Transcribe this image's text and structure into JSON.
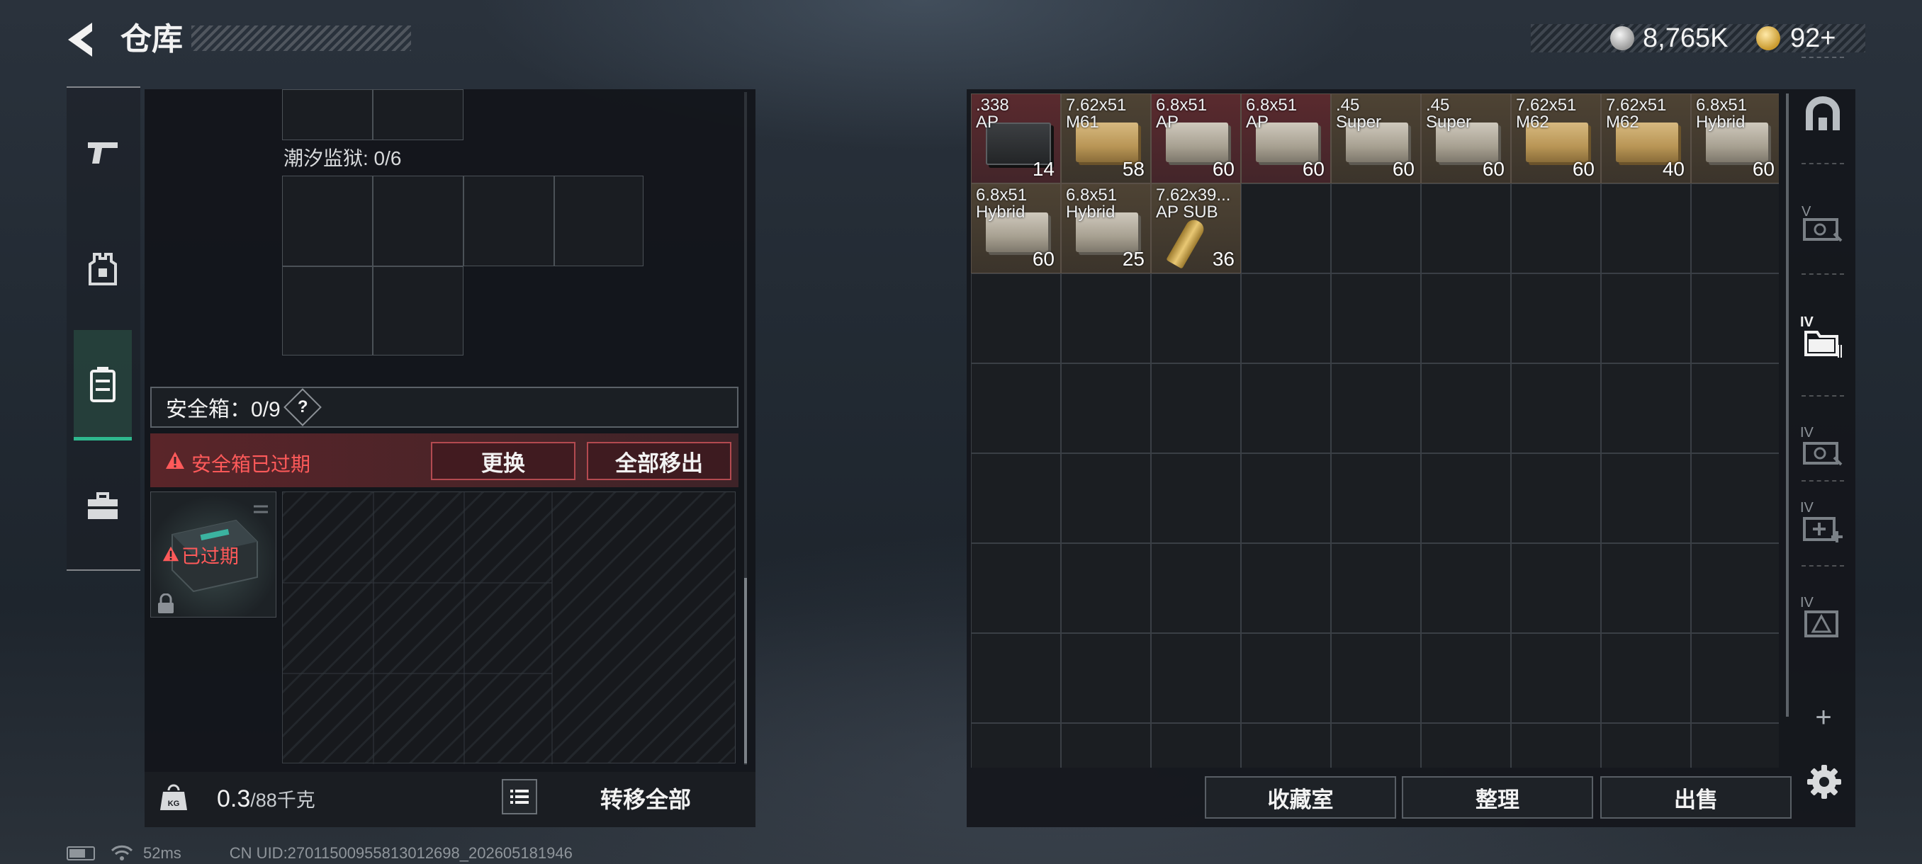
{
  "header": {
    "title": "仓库"
  },
  "currency": {
    "silver": "8,765K",
    "gold": "92+"
  },
  "left_panel": {
    "tide_prison_label": "潮汐监狱: 0/6",
    "safebox_label": "安全箱：0/9",
    "help": "?",
    "expired_banner": "安全箱已过期",
    "replace_button": "更换",
    "move_all_out_button": "全部移出",
    "safebox_status": "已过期",
    "weight_value": "0.3",
    "weight_cap": "/88千克",
    "transfer_all_button": "转移全部"
  },
  "stash": {
    "items": [
      {
        "name": ".338\nAP",
        "count": "14",
        "bg": "red",
        "box": "dark"
      },
      {
        "name": "7.62x51\nM61",
        "count": "58",
        "bg": "tan",
        "box": "tan"
      },
      {
        "name": "6.8x51\nAP",
        "count": "60",
        "bg": "red",
        "box": "silver"
      },
      {
        "name": "6.8x51\nAP",
        "count": "60",
        "bg": "red",
        "box": "silver"
      },
      {
        "name": ".45\nSuper",
        "count": "60",
        "bg": "tan",
        "box": "silver"
      },
      {
        "name": ".45\nSuper",
        "count": "60",
        "bg": "tan",
        "box": "silver"
      },
      {
        "name": "7.62x51\nM62",
        "count": "60",
        "bg": "tan",
        "box": "tan"
      },
      {
        "name": "7.62x51\nM62",
        "count": "40",
        "bg": "tan",
        "box": "tan"
      },
      {
        "name": "6.8x51\nHybrid",
        "count": "60",
        "bg": "tan",
        "box": "silver"
      },
      {
        "name": "6.8x51\nHybrid",
        "count": "60",
        "bg": "tan",
        "box": "silver"
      },
      {
        "name": "6.8x51\nHybrid",
        "count": "25",
        "bg": "tan",
        "box": "silver"
      },
      {
        "name": "7.62x39...\nAP SUB",
        "count": "36",
        "bg": "tan",
        "box": "round"
      }
    ],
    "collection_button": "收藏室",
    "organize_button": "整理",
    "sell_button": "出售"
  },
  "right_rail": {
    "labels": [
      "V",
      "IV",
      "IV",
      "IV",
      "IV"
    ],
    "add": "+"
  },
  "status_bar": {
    "ping": "52ms",
    "uid": "CN UID:27011500955813012698_202605181946"
  },
  "colors": {
    "accent_green": "#2fb88e",
    "warning_red": "#ff5a5a",
    "item_red": "#5a2a2e",
    "item_tan": "#4e4334"
  }
}
